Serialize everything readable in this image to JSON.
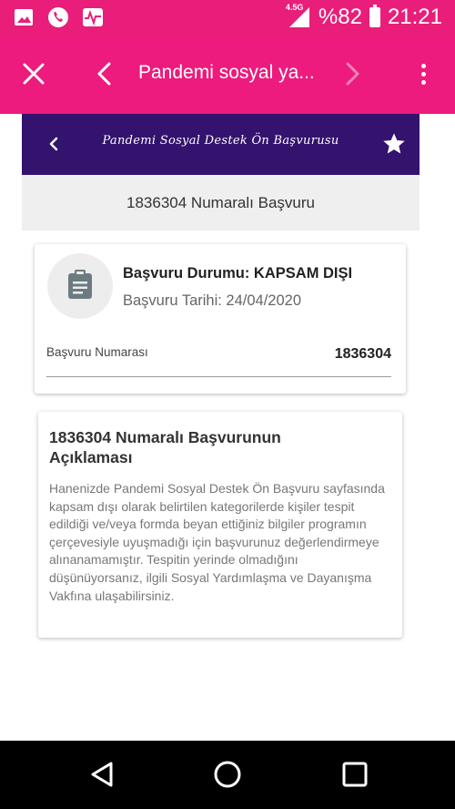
{
  "status_bar": {
    "network": "4.5G",
    "battery": "%82",
    "time": "21:21"
  },
  "browser": {
    "title": "Pandemi sosyal ya..."
  },
  "page_header": {
    "title": "Pandemi Sosyal Destek Ön Başvurusu"
  },
  "subheader": {
    "text": "1836304 Numaralı Başvuru"
  },
  "application_card": {
    "status": "Başvuru Durumu: KAPSAM DIŞI",
    "date": "Başvuru Tarihi: 24/04/2020",
    "number_label": "Başvuru Numarası",
    "number_value": "1836304"
  },
  "explanation_card": {
    "title": "1836304 Numaralı Başvurunun Açıklaması",
    "body": "Hanenizde Pandemi Sosyal Destek Ön Başvuru sayfasında kapsam dışı olarak belirtilen kategorilerde kişiler tespit edildiği ve/veya formda beyan ettiğiniz bilgiler programın çerçevesiyle uyuşmadığı için başvurunuz değerlendirmeye alınanamamıştır. Tespitin yerinde olmadığını düşünüyorsanız, ilgili Sosyal Yardımlaşma ve Dayanışma Vakfına ulaşabilirsiniz."
  },
  "colors": {
    "status_bar": "#e91e7a",
    "toolbar": "#ec1b7d",
    "page_header": "#33136d"
  },
  "icons": {
    "status_left": [
      "image-icon",
      "phone-icon",
      "activity-icon"
    ],
    "toolbar": [
      "close-icon",
      "back-arrow-icon",
      "forward-arrow-icon",
      "more-vert-icon"
    ],
    "page_header": [
      "back-chevron-icon",
      "star-icon"
    ],
    "card": "clipboard-icon",
    "navigation": [
      "nav-back-icon",
      "nav-home-icon",
      "nav-recents-icon"
    ]
  }
}
